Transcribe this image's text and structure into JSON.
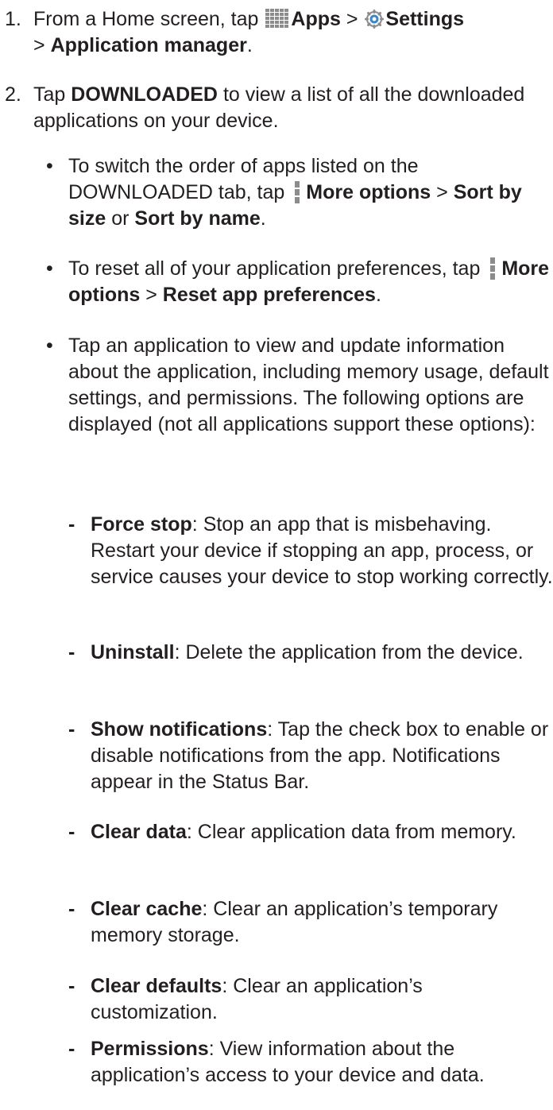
{
  "steps": [
    {
      "number": "1.",
      "pre": "From a Home screen, tap",
      "apps": "Apps",
      "sep1": ">",
      "settings": "Settings",
      "sep2": ">",
      "app_manager": "Application manager",
      "end": "."
    },
    {
      "number": "2.",
      "pre": "Tap",
      "downloaded": "DOWNLOADED",
      "post": "to view a list of all the downloaded applications on your device."
    }
  ],
  "bullets": [
    {
      "dot": "•",
      "pre": "To switch the order of apps listed on the DOWNLOADED tab, tap",
      "more": "More options",
      "sep": ">",
      "size": "Sort by size",
      "or": "or",
      "name": "Sort by name",
      "end": "."
    },
    {
      "dot": "•",
      "pre": "To reset all of your application preferences, tap",
      "more": "More options",
      "sep": ">",
      "reset": "Reset app preferences",
      "end": "."
    },
    {
      "dot": "•",
      "text": "Tap an application to view and update information about the application, including memory usage, default settings, and permissions. The following options are displayed (not all applications support these options):"
    }
  ],
  "options": [
    {
      "mark": "-",
      "term": "Force stop",
      "desc": ": Stop an app that is misbehaving. Restart your device if stopping an app, process, or service causes your device to stop working correctly."
    },
    {
      "mark": "-",
      "term": "Uninstall",
      "desc": ": Delete the application from the device."
    },
    {
      "mark": "-",
      "term": "Show notifications",
      "desc": ": Tap the check box to enable or disable notifications from the app. Notifications appear in the Status Bar."
    },
    {
      "mark": "-",
      "term": "Clear data",
      "desc": ": Clear application data from memory."
    },
    {
      "mark": "-",
      "term": "Clear cache",
      "desc": ": Clear an application’s temporary memory storage."
    },
    {
      "mark": "-",
      "term": "Clear defaults",
      "desc": ": Clear an application’s customization."
    },
    {
      "mark": "-",
      "term": "Permissions",
      "desc": ": View information about the application’s access to your device and data."
    }
  ],
  "icons": {
    "apps": "apps-grid-icon",
    "settings": "settings-gear-icon",
    "more": "more-options-icon"
  },
  "colors": {
    "text": "#231f20",
    "icon_gray": "#8c8c8c",
    "gear_blue": "#3a86c8"
  }
}
